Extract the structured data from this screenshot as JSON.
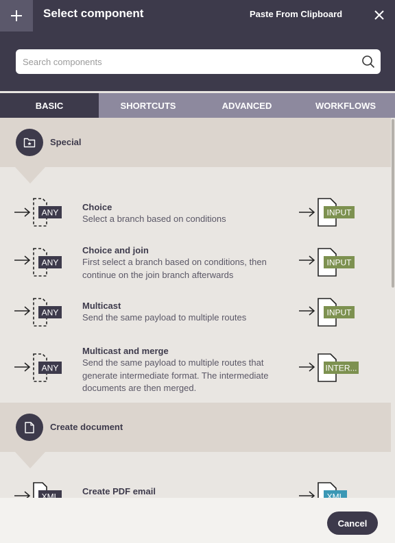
{
  "header": {
    "title": "Select component",
    "paste_label": "Paste From Clipboard",
    "add_icon": "plus-icon",
    "close_icon": "close-icon"
  },
  "search": {
    "placeholder": "Search components",
    "value": "",
    "icon": "search-icon"
  },
  "tabs": [
    {
      "label": "BASIC",
      "active": true
    },
    {
      "label": "SHORTCUTS",
      "active": false
    },
    {
      "label": "ADVANCED",
      "active": false
    },
    {
      "label": "WORKFLOWS",
      "active": false
    }
  ],
  "categories": [
    {
      "label": "Special",
      "icon": "folder-star-icon",
      "items": [
        {
          "name": "Choice",
          "description": "Select a branch based on conditions",
          "input_type": "ANY",
          "output_type": "INPUT"
        },
        {
          "name": "Choice and join",
          "description": "First select a branch based on conditions, then continue on the join branch afterwards",
          "input_type": "ANY",
          "output_type": "INPUT"
        },
        {
          "name": "Multicast",
          "description": "Send the same payload to multiple routes",
          "input_type": "ANY",
          "output_type": "INPUT"
        },
        {
          "name": "Multicast and merge",
          "description": "Send the same payload to multiple routes that generate intermediate format. The intermediate documents are then merged.",
          "input_type": "ANY",
          "output_type": "INTER..."
        }
      ]
    },
    {
      "label": "Create document",
      "icon": "document-icon",
      "items": [
        {
          "name": "Create PDF email",
          "description": "",
          "input_type": "XML",
          "output_type": "XML"
        }
      ]
    }
  ],
  "footer": {
    "cancel_label": "Cancel"
  },
  "colors": {
    "header_bg": "#3d3a4b",
    "tab_inactive_bg": "#8d899e",
    "category_bg": "#dcd5ce",
    "content_bg": "#e9e6e2",
    "output_badge": "#7d9150",
    "input_badge": "#3d3a4b",
    "xml_badge": "#3b98b5"
  }
}
